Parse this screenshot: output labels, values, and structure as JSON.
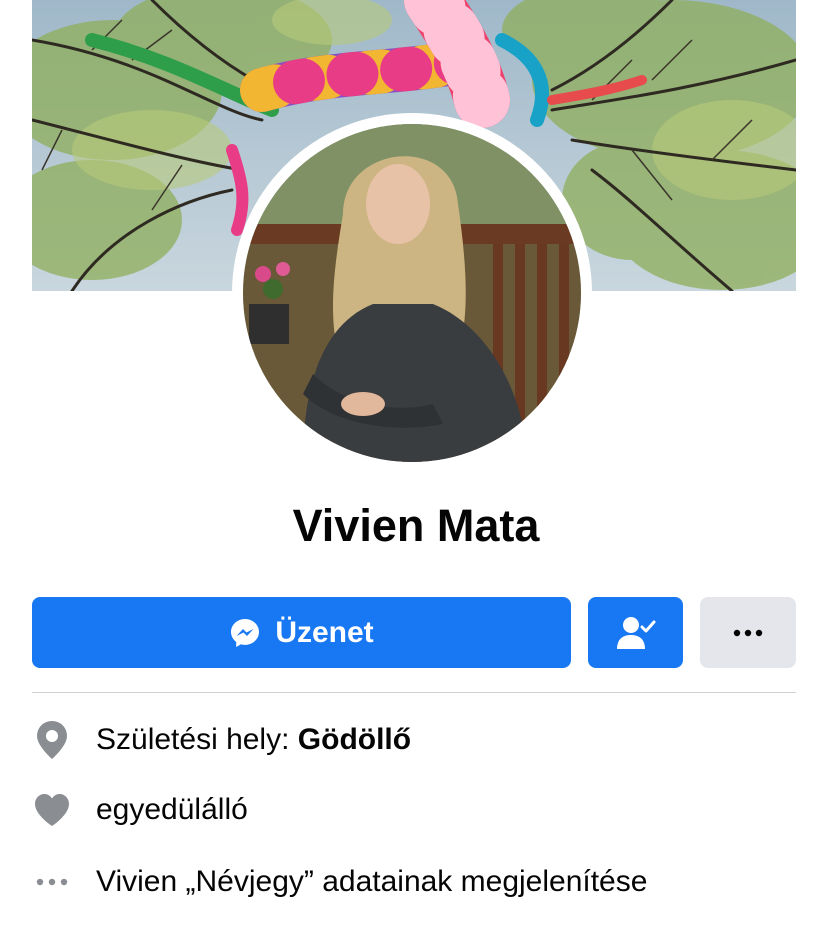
{
  "profile": {
    "name": "Vivien Mata"
  },
  "actions": {
    "message_label": "Üzenet",
    "friend_icon": "friends-check-icon",
    "more_icon": "more-dots-icon"
  },
  "info": {
    "birthplace_label": "Születési hely: ",
    "birthplace_value": "Gödöllő",
    "relationship": "egyedülálló",
    "about_link": "Vivien „Névjegy” adatainak megjelenítése"
  },
  "colors": {
    "accent": "#1877f2",
    "secondary_button": "#e4e6eb",
    "icon_gray": "#8a8d91",
    "text": "#050505"
  }
}
